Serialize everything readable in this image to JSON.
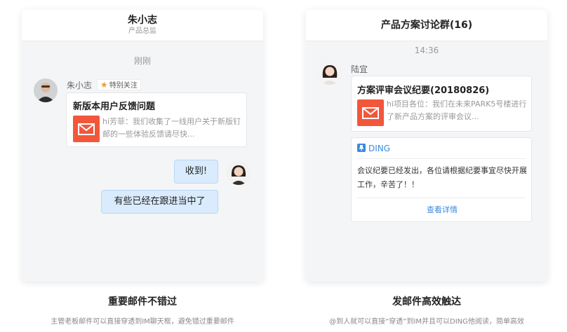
{
  "left_chat": {
    "header": {
      "name": "朱小志",
      "subtitle": "产品总监"
    },
    "timestamp": "刚刚",
    "sender_name": "朱小志",
    "sender_badge": "特别关注",
    "mail_card": {
      "title": "新版本用户反馈问题",
      "preview": "hi芳菲：我们收集了一线用户关于新版钉邮的一些体验反馈请尽快..."
    },
    "reply_1": "收到!",
    "reply_2": "有些已经在跟进当中了"
  },
  "right_chat": {
    "header": {
      "title": "产品方案讨论群(16)"
    },
    "timestamp": "14:36",
    "sender_name": "陆宜",
    "mail_card": {
      "title": "方案评审会议纪要(20180826)",
      "preview": "hi项目各位：我们在未来PARK5号楼进行了新产品方案的评审会议..."
    },
    "ding_card": {
      "tag": "DING",
      "text": "会议纪要已经发出，各位请根据纪要事宜尽快开展工作，辛苦了！！",
      "link": "查看详情"
    }
  },
  "captions": {
    "left_title": "重要邮件不错过",
    "left_sub": "主管老板邮件可以直接穿透到IM聊天框，避免错过重要邮件",
    "right_title": "发邮件高效触达",
    "right_sub": "@到人就可以直接“穿透”到IM并且可以DING他阅读，简单高效"
  },
  "colors": {
    "accent": "#3c8ae0",
    "mail": "#f2573c",
    "bubble": "#d9ebfc",
    "star": "#f09a3d"
  },
  "icons": [
    "star-icon",
    "mail-icon",
    "pin-icon"
  ]
}
